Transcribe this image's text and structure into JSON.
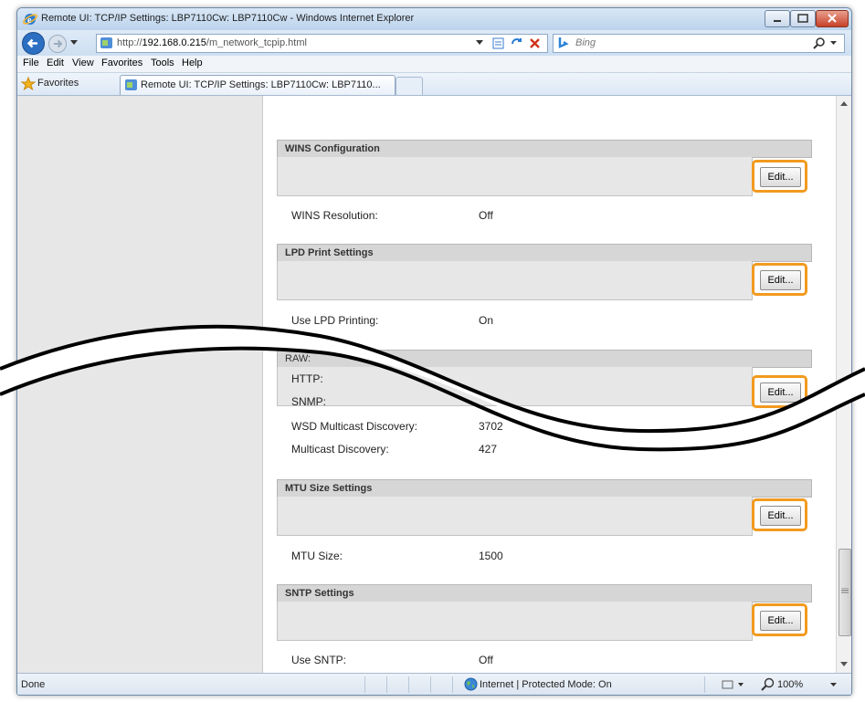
{
  "window": {
    "title": "Remote UI: TCP/IP Settings: LBP7110Cw: LBP7110Cw - Windows Internet Explorer"
  },
  "address_bar": {
    "url_prefix": "http://",
    "url_host": "192.168.0.215",
    "url_path": "/m_network_tcpip.html"
  },
  "search": {
    "placeholder": "Bing"
  },
  "menu": {
    "items": [
      "File",
      "Edit",
      "View",
      "Favorites",
      "Tools",
      "Help"
    ]
  },
  "favorites_bar": {
    "favorites_label": "Favorites",
    "tab_title": "Remote UI: TCP/IP Settings: LBP7110Cw: LBP7110..."
  },
  "sections": {
    "wins": {
      "title": "WINS Configuration",
      "edit_label": "Edit...",
      "fields": [
        {
          "label": "WINS Resolution:",
          "value": "Off"
        }
      ]
    },
    "lpd": {
      "title": "LPD Print Settings",
      "edit_label": "Edit...",
      "fields": [
        {
          "label": "Use LPD Printing:",
          "value": "On"
        }
      ]
    },
    "ports": {
      "title_fragment": "RAW:",
      "edit_label": "Edit...",
      "fields": [
        {
          "label": "HTTP:",
          "value": ""
        },
        {
          "label": "SNMP:",
          "value": ""
        },
        {
          "label": "WSD Multicast Discovery:",
          "value": "3702"
        },
        {
          "label": "Multicast Discovery:",
          "value": "427"
        }
      ]
    },
    "mtu": {
      "title": "MTU Size Settings",
      "edit_label": "Edit...",
      "fields": [
        {
          "label": "MTU Size:",
          "value": "1500"
        }
      ]
    },
    "sntp": {
      "title": "SNTP Settings",
      "edit_label": "Edit...",
      "fields": [
        {
          "label": "Use SNTP:",
          "value": "Off"
        }
      ]
    }
  },
  "status_bar": {
    "status": "Done",
    "zone": "Internet | Protected Mode: On",
    "zoom": "100%"
  },
  "colors": {
    "highlight": "#f29a1f",
    "header_gray": "#d6d6d6",
    "panel_gray": "#e7e7e7"
  },
  "icons": [
    "ie-logo-icon",
    "back-arrow-icon",
    "forward-arrow-icon",
    "page-icon",
    "refresh-icon",
    "stop-icon",
    "bing-icon",
    "search-icon",
    "favorites-star-icon",
    "globe-icon"
  ]
}
